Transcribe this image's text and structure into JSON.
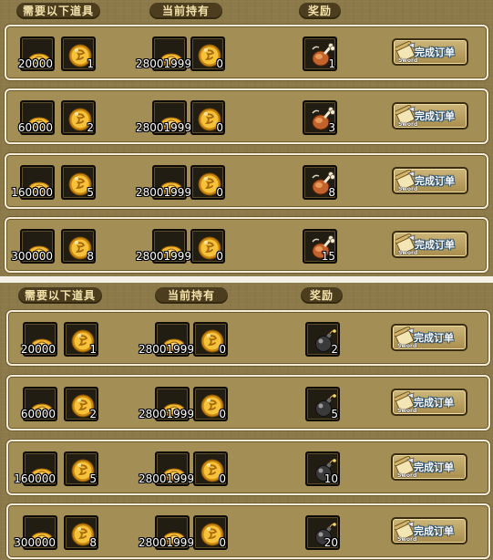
{
  "panels": [
    {
      "headers": {
        "required": "需要以下道具",
        "owned": "当前持有",
        "reward": "奖励"
      },
      "rows": [
        {
          "need_a": "20000",
          "need_b": "1",
          "own_a": "28001999",
          "own_b": "0",
          "reward_icon": "meat-leg-icon",
          "reward_qty": "1",
          "button": "完成订单",
          "button_tag": "Sword"
        },
        {
          "need_a": "60000",
          "need_b": "2",
          "own_a": "28001999",
          "own_b": "0",
          "reward_icon": "meat-leg-icon",
          "reward_qty": "3",
          "button": "完成订单",
          "button_tag": "Sword"
        },
        {
          "need_a": "160000",
          "need_b": "5",
          "own_a": "28001999",
          "own_b": "0",
          "reward_icon": "meat-leg-icon",
          "reward_qty": "8",
          "button": "完成订单",
          "button_tag": "Sword"
        },
        {
          "need_a": "300000",
          "need_b": "8",
          "own_a": "28001999",
          "own_b": "0",
          "reward_icon": "meat-leg-icon",
          "reward_qty": "15",
          "button": "完成订单",
          "button_tag": "Sword"
        }
      ]
    },
    {
      "headers": {
        "required": "需要以下道具",
        "owned": "当前持有",
        "reward": "奖励"
      },
      "rows": [
        {
          "need_a": "20000",
          "need_b": "1",
          "own_a": "28001999",
          "own_b": "0",
          "reward_icon": "bomb-icon",
          "reward_qty": "2",
          "button": "完成订单",
          "button_tag": "Sword"
        },
        {
          "need_a": "60000",
          "need_b": "2",
          "own_a": "28001999",
          "own_b": "0",
          "reward_icon": "bomb-icon",
          "reward_qty": "5",
          "button": "完成订单",
          "button_tag": "Sword"
        },
        {
          "need_a": "160000",
          "need_b": "5",
          "own_a": "28001999",
          "own_b": "0",
          "reward_icon": "bomb-icon",
          "reward_qty": "10",
          "button": "完成订单",
          "button_tag": "Sword"
        },
        {
          "need_a": "300000",
          "need_b": "8",
          "own_a": "28001999",
          "own_b": "0",
          "reward_icon": "bomb-icon",
          "reward_qty": "20",
          "button": "完成订单",
          "button_tag": "Sword"
        }
      ]
    }
  ],
  "colors": {
    "panel_bg": "#8c7a4a",
    "row_bg": "#a38e56",
    "header_bg": "#4c3d1f",
    "header_text": "#f4e3ac",
    "slot_bg": "#221d12",
    "coin": "#f0b228"
  }
}
